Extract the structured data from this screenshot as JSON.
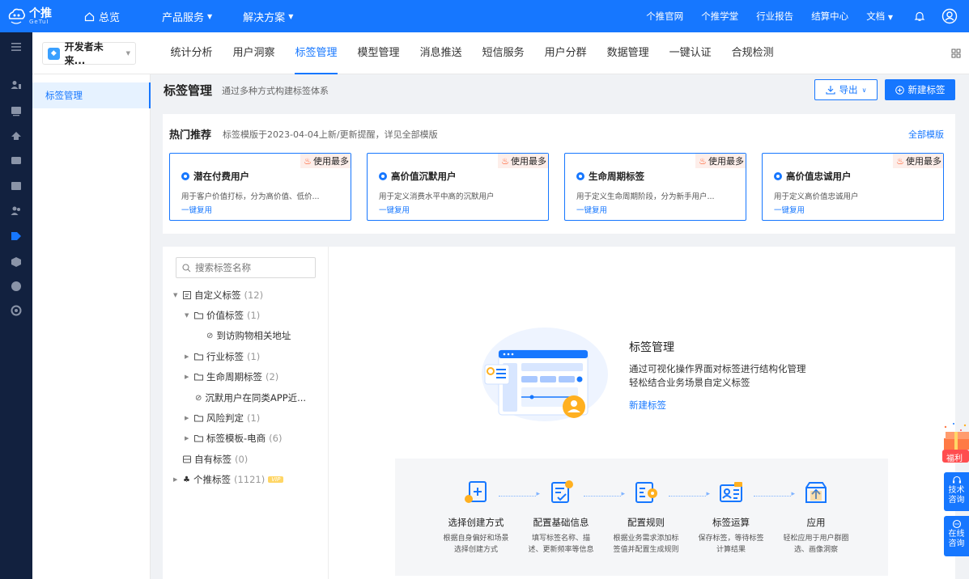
{
  "topbar": {
    "logo_main": "个推",
    "logo_sub": "GeTuI",
    "home": "总览",
    "menus": [
      "产品服务",
      "解决方案"
    ],
    "links": [
      "个推官网",
      "个推学堂",
      "行业报告",
      "结算中心",
      "文档"
    ]
  },
  "subbar": {
    "project": "开发者未来...",
    "tabs": [
      "统计分析",
      "用户洞察",
      "标签管理",
      "模型管理",
      "消息推送",
      "短信服务",
      "用户分群",
      "数据管理",
      "一键认证",
      "合规检测"
    ],
    "active_tab": "标签管理"
  },
  "side": {
    "active_item": "标签管理"
  },
  "header": {
    "title": "标签管理",
    "subtitle": "通过多种方式构建标签体系",
    "export_label": "导出",
    "new_label": "新建标签"
  },
  "hot": {
    "title": "热门推荐",
    "note": "标签模版于2023-04-04上新/更新提醒，详见全部模版",
    "all_link": "全部模版",
    "cards": [
      {
        "badge": "使用最多",
        "name": "潜在付费用户",
        "desc": "用于客户价值打标，分为高价值、低价...",
        "link": "一键复用"
      },
      {
        "badge": "使用最多",
        "name": "高价值沉默用户",
        "desc": "用于定义消费水平中高的沉默用户",
        "link": "一键复用"
      },
      {
        "badge": "使用最多",
        "name": "生命周期标签",
        "desc": "用于定义生命周期阶段，分为新手用户...",
        "link": "一键复用"
      },
      {
        "badge": "使用最多",
        "name": "高价值忠诚用户",
        "desc": "用于定义高价值忠诚用户",
        "link": "一键复用"
      }
    ]
  },
  "tree": {
    "search_placeholder": "搜索标签名称",
    "nodes": [
      {
        "label": "自定义标签",
        "count": "(12)"
      },
      {
        "label": "价值标签",
        "count": "(1)"
      },
      {
        "label": "到访购物相关地址",
        "count": ""
      },
      {
        "label": "行业标签",
        "count": "(1)"
      },
      {
        "label": "生命周期标签",
        "count": "(2)"
      },
      {
        "label": "沉默用户在同类APP近...",
        "count": ""
      },
      {
        "label": "风险判定",
        "count": "(1)"
      },
      {
        "label": "标签模板-电商",
        "count": "(6)"
      },
      {
        "label": "自有标签",
        "count": "(0)"
      },
      {
        "label": "个推标签",
        "count": "(1121)"
      }
    ],
    "vip": "VIP"
  },
  "empty": {
    "title": "标签管理",
    "line1": "通过可视化操作界面对标签进行结构化管理",
    "line2": "轻松结合业务场景自定义标签",
    "link": "新建标签"
  },
  "flow": {
    "steps": [
      {
        "title": "选择创建方式",
        "desc1": "根据自身偏好和场景",
        "desc2": "选择创建方式"
      },
      {
        "title": "配置基础信息",
        "desc1": "填写标签名称、描",
        "desc2": "述、更新频率等信息"
      },
      {
        "title": "配置规则",
        "desc1": "根据业务需求添加标",
        "desc2": "签值并配置生成规则"
      },
      {
        "title": "标签运算",
        "desc1": "保存标签，等待标签",
        "desc2": "计算结果"
      },
      {
        "title": "应用",
        "desc1": "轻松应用于用户群圈",
        "desc2": "选、画像洞察"
      }
    ]
  },
  "floats": {
    "gift": "福利",
    "tech": "技术咨询",
    "online": "在线咨询"
  },
  "colors": {
    "primary": "#1677ff",
    "rail": "#12213f",
    "fire": "#ff4d1a"
  }
}
